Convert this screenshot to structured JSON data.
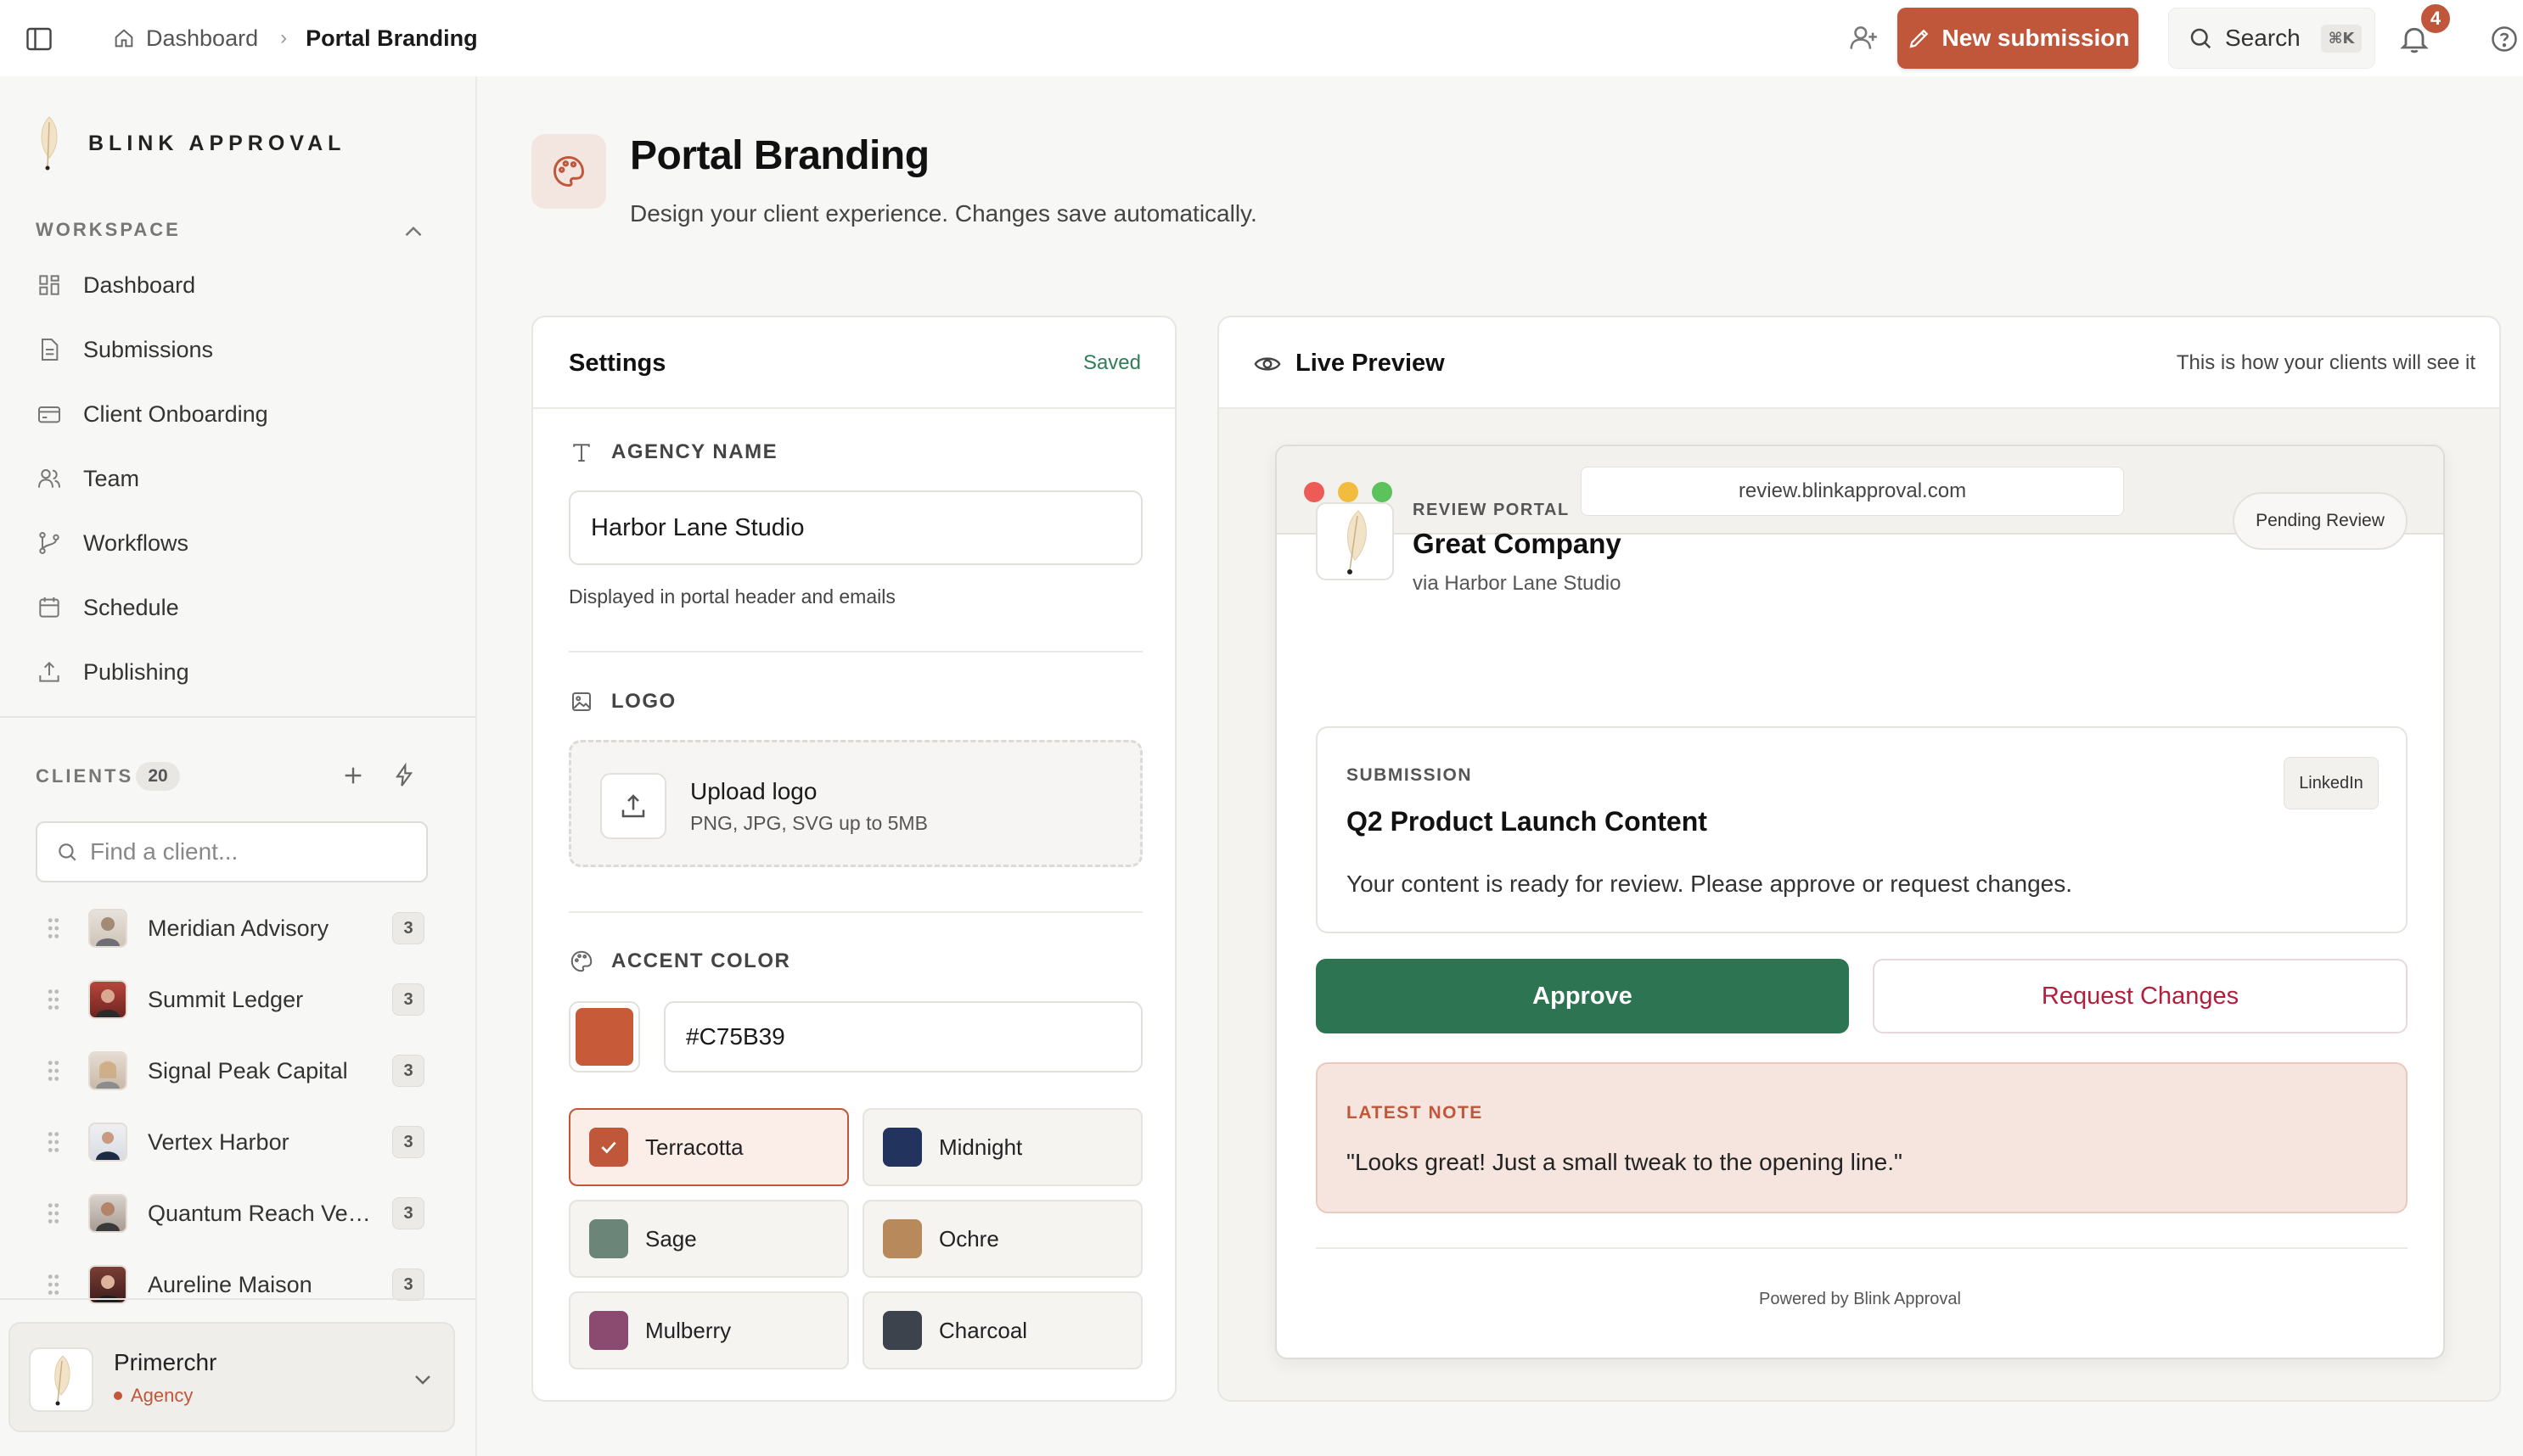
{
  "header": {
    "breadcrumb_home": "Dashboard",
    "breadcrumb_current": "Portal Branding",
    "new_submission_label": "New submission",
    "search_label": "Search",
    "search_shortcut": "⌘K",
    "notification_count": "4"
  },
  "sidebar": {
    "brand_name": "BLINK APPROVAL",
    "workspace_label": "WORKSPACE",
    "nav": [
      {
        "label": "Dashboard",
        "icon": "dashboard-grid-icon"
      },
      {
        "label": "Submissions",
        "icon": "document-icon"
      },
      {
        "label": "Client Onboarding",
        "icon": "card-icon"
      },
      {
        "label": "Team",
        "icon": "users-icon"
      },
      {
        "label": "Workflows",
        "icon": "workflow-icon"
      },
      {
        "label": "Schedule",
        "icon": "calendar-icon"
      },
      {
        "label": "Publishing",
        "icon": "upload-icon"
      }
    ],
    "clients_label": "CLIENTS",
    "clients_count": "20",
    "client_search_placeholder": "Find a client...",
    "clients": [
      {
        "name": "Meridian Advisory",
        "count": "3"
      },
      {
        "name": "Summit Ledger",
        "count": "3"
      },
      {
        "name": "Signal Peak Capital",
        "count": "3"
      },
      {
        "name": "Vertex Harbor",
        "count": "3"
      },
      {
        "name": "Quantum Reach Ven...",
        "count": "3"
      },
      {
        "name": "Aureline Maison",
        "count": "3"
      }
    ],
    "account": {
      "name": "Primerchr",
      "role": "Agency"
    }
  },
  "page": {
    "title": "Portal Branding",
    "subtitle": "Design your client experience. Changes save automatically."
  },
  "settings": {
    "title": "Settings",
    "status": "Saved",
    "agency_name_label": "AGENCY NAME",
    "agency_name_value": "Harbor Lane Studio",
    "agency_name_help": "Displayed in portal header and emails",
    "logo_label": "LOGO",
    "upload_title": "Upload logo",
    "upload_sub": "PNG, JPG, SVG up to 5MB",
    "accent_label": "ACCENT COLOR",
    "accent_hex": "#C75B39",
    "presets": [
      {
        "name": "Terracotta",
        "color": "#c0563a",
        "selected": true
      },
      {
        "name": "Midnight",
        "color": "#22345e",
        "selected": false
      },
      {
        "name": "Sage",
        "color": "#6b8678",
        "selected": false
      },
      {
        "name": "Ochre",
        "color": "#b8895a",
        "selected": false
      },
      {
        "name": "Mulberry",
        "color": "#8b4a70",
        "selected": false
      },
      {
        "name": "Charcoal",
        "color": "#3d434c",
        "selected": false
      }
    ]
  },
  "preview": {
    "title": "Live Preview",
    "note": "This is how your clients will see it",
    "url": "review.blinkapproval.com",
    "portal_label": "REVIEW PORTAL",
    "company": "Great Company",
    "via": "via Harbor Lane Studio",
    "status_pill": "Pending Review",
    "submission_label": "SUBMISSION",
    "submission_title": "Q2 Product Launch Content",
    "submission_body": "Your content is ready for review. Please approve or request changes.",
    "platform": "LinkedIn",
    "approve_label": "Approve",
    "changes_label": "Request Changes",
    "note_label": "LATEST NOTE",
    "note_text": "\"Looks great! Just a small tweak to the opening line.\"",
    "powered_by": "Powered by Blink Approval"
  },
  "colors": {
    "accent": "#c0563a",
    "approve": "#2d7552",
    "saved": "#2f7d55",
    "changes": "#b0203c"
  }
}
